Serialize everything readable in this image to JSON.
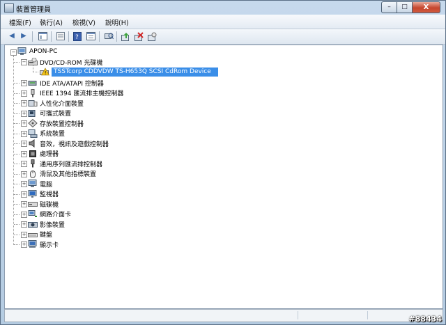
{
  "window": {
    "title": "裝置管理員"
  },
  "window_controls": {
    "minimize": "–",
    "maximize": "□",
    "close": "X"
  },
  "menu": [
    "檔案(F)",
    "執行(A)",
    "檢視(V)",
    "說明(H)"
  ],
  "toolbar": [
    "back-icon",
    "forward-icon",
    "properties-pane-icon",
    "view-toggle-icon",
    "help-icon",
    "resource-view-icon",
    "scan-hardware-icon",
    "update-driver-icon",
    "disable-device-icon",
    "uninstall-icon"
  ],
  "tree": {
    "root": "APON-PC",
    "dvd_category": "DVD/CD-ROM 光碟機",
    "dvd_device": "TSSTcorp CDDVDW TS-H653Q SCSI CdRom Device",
    "categories": [
      "IDE ATA/ATAPI 控制器",
      "IEEE 1394 匯流排主機控制器",
      "人性化介面裝置",
      "可攜式裝置",
      "存放裝置控制器",
      "系統裝置",
      "音效，視訊及遊戲控制器",
      "處理器",
      "通用序列匯流排控制器",
      "滑鼠及其他指標裝置",
      "電腦",
      "監視器",
      "磁碟機",
      "網路介面卡",
      "影像裝置",
      "鍵盤",
      "顯示卡"
    ]
  },
  "watermark": "#88434",
  "colors": {
    "selection": "#3a8ee8",
    "window_frame": "#bcd3e6"
  }
}
